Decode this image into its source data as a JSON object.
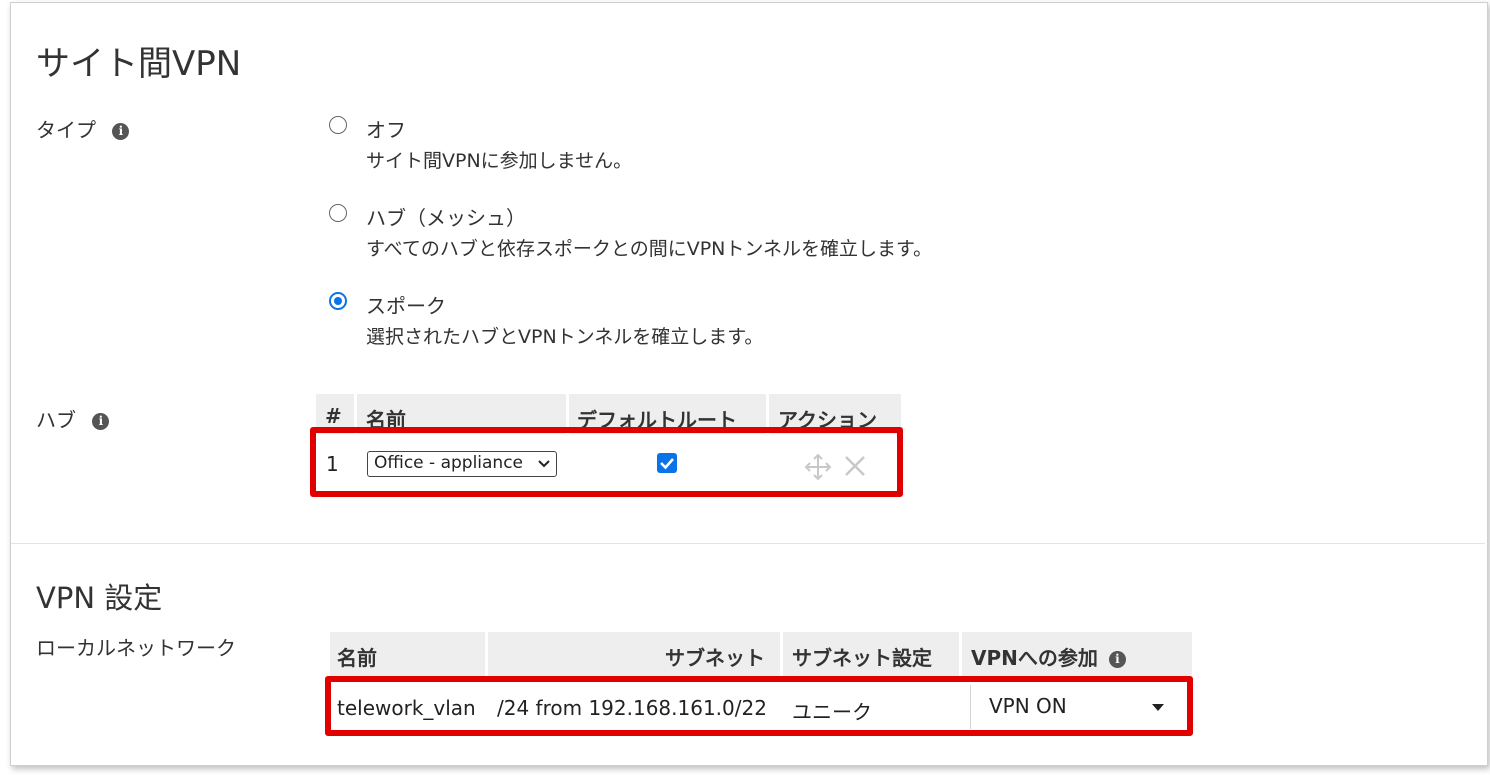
{
  "site_vpn": {
    "title": "サイト間VPN",
    "type": {
      "label": "タイプ",
      "options": [
        {
          "name": "オフ",
          "description": "サイト間VPNに参加しません。",
          "selected": false
        },
        {
          "name": "ハブ（メッシュ）",
          "description": "すべてのハブと依存スポークとの間にVPNトンネルを確立します。",
          "selected": false
        },
        {
          "name": "スポーク",
          "description": "選択されたハブとVPNトンネルを確立します。",
          "selected": true
        }
      ]
    },
    "hubs": {
      "label": "ハブ",
      "columns": {
        "index": "#",
        "name": "名前",
        "default_route": "デフォルトルート",
        "action": "アクション"
      },
      "rows": [
        {
          "index": "1",
          "name": "Office - appliance",
          "default_route": true
        }
      ]
    }
  },
  "vpn_settings": {
    "title": "VPN 設定",
    "local_network": {
      "label": "ローカルネットワーク",
      "columns": {
        "name": "名前",
        "subnet": "サブネット",
        "subnet_setting": "サブネット設定",
        "vpn_participation": "VPNへの参加"
      },
      "rows": [
        {
          "name": "telework_vlan",
          "subnet": "/24 from 192.168.161.0/22",
          "subnet_setting": "ユニーク",
          "vpn_participation": "VPN ON"
        }
      ]
    }
  },
  "icons": {
    "info": "info-icon",
    "move": "move-icon",
    "delete": "close-icon",
    "dropdown": "chevron-down-icon"
  },
  "colors": {
    "accent": "#0a73e8",
    "highlight": "#e00000"
  }
}
